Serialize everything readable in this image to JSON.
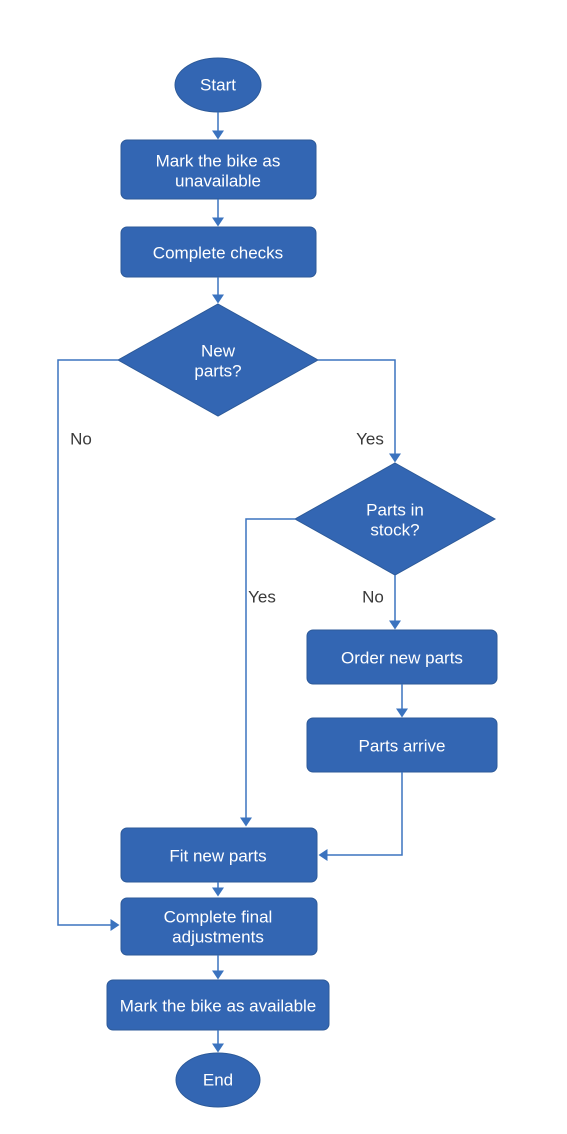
{
  "chart_data": {
    "type": "flowchart",
    "nodes": [
      {
        "id": "start",
        "type": "terminal",
        "label": "Start"
      },
      {
        "id": "mark_unavailable",
        "type": "process",
        "label_line1": "Mark the bike as",
        "label_line2": "unavailable"
      },
      {
        "id": "complete_checks",
        "type": "process",
        "label": "Complete checks"
      },
      {
        "id": "new_parts",
        "type": "decision",
        "label_line1": "New",
        "label_line2": "parts?"
      },
      {
        "id": "parts_in_stock",
        "type": "decision",
        "label_line1": "Parts in",
        "label_line2": "stock?"
      },
      {
        "id": "order_parts",
        "type": "process",
        "label": "Order new parts"
      },
      {
        "id": "parts_arrive",
        "type": "process",
        "label": "Parts arrive"
      },
      {
        "id": "fit_parts",
        "type": "process",
        "label": "Fit new parts"
      },
      {
        "id": "final_adj",
        "type": "process",
        "label_line1": "Complete final",
        "label_line2": "adjustments"
      },
      {
        "id": "mark_available",
        "type": "process",
        "label": "Mark the bike as available"
      },
      {
        "id": "end",
        "type": "terminal",
        "label": "End"
      }
    ],
    "edges": [
      {
        "from": "start",
        "to": "mark_unavailable"
      },
      {
        "from": "mark_unavailable",
        "to": "complete_checks"
      },
      {
        "from": "complete_checks",
        "to": "new_parts"
      },
      {
        "from": "new_parts",
        "to": "final_adj",
        "label": "No"
      },
      {
        "from": "new_parts",
        "to": "parts_in_stock",
        "label": "Yes"
      },
      {
        "from": "parts_in_stock",
        "to": "fit_parts",
        "label": "Yes"
      },
      {
        "from": "parts_in_stock",
        "to": "order_parts",
        "label": "No"
      },
      {
        "from": "order_parts",
        "to": "parts_arrive"
      },
      {
        "from": "parts_arrive",
        "to": "fit_parts"
      },
      {
        "from": "fit_parts",
        "to": "final_adj"
      },
      {
        "from": "final_adj",
        "to": "mark_available"
      },
      {
        "from": "mark_available",
        "to": "end"
      }
    ],
    "edge_labels": {
      "no": "No",
      "yes": "Yes"
    }
  }
}
